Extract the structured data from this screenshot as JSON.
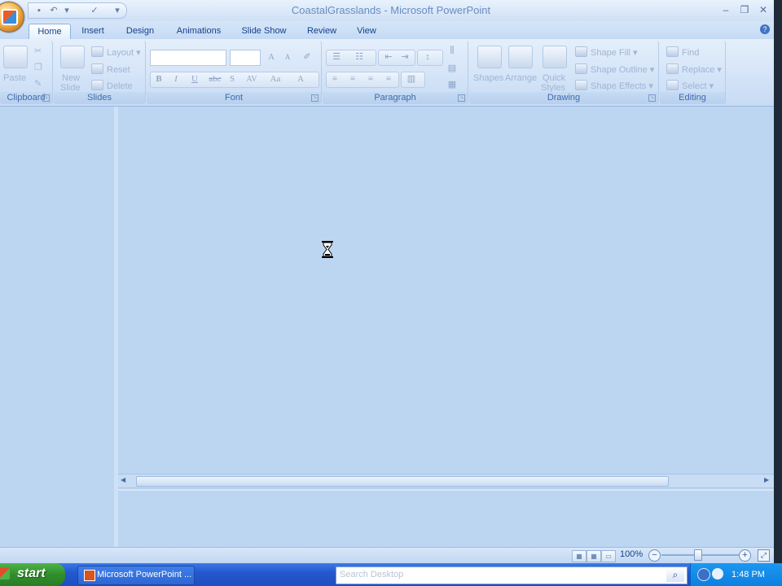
{
  "window": {
    "title": "CoastalGrasslands - Microsoft PowerPoint"
  },
  "quick_access": {
    "items": [
      "save-icon",
      "undo-icon",
      "spelling-icon",
      "customize-icon"
    ]
  },
  "tabs": [
    {
      "label": "Home",
      "active": true
    },
    {
      "label": "Insert"
    },
    {
      "label": "Design"
    },
    {
      "label": "Animations"
    },
    {
      "label": "Slide Show"
    },
    {
      "label": "Review"
    },
    {
      "label": "View"
    }
  ],
  "ribbon": {
    "clipboard": {
      "group_label": "Clipboard",
      "paste": "Paste"
    },
    "slides": {
      "group_label": "Slides",
      "new_slide_line1": "New",
      "new_slide_line2": "Slide",
      "layout": "Layout",
      "reset": "Reset",
      "delete": "Delete"
    },
    "font": {
      "group_label": "Font",
      "bold": "B",
      "italic": "I",
      "underline": "U",
      "strike": "abc",
      "shadow": "S",
      "spacing": "AV",
      "change_case": "Aa",
      "font_color": "A",
      "grow": "A",
      "shrink": "A"
    },
    "paragraph": {
      "group_label": "Paragraph"
    },
    "drawing": {
      "group_label": "Drawing",
      "shapes": "Shapes",
      "arrange": "Arrange",
      "quick_styles_line1": "Quick",
      "quick_styles_line2": "Styles",
      "shape_fill": "Shape Fill",
      "shape_outline": "Shape Outline",
      "shape_effects": "Shape Effects"
    },
    "editing": {
      "group_label": "Editing",
      "find": "Find",
      "replace": "Replace",
      "select": "Select"
    }
  },
  "statusbar": {
    "zoom": "100%",
    "zoom_out": "−",
    "zoom_in": "+"
  },
  "taskbar": {
    "start_label": "start",
    "task_item": "Microsoft PowerPoint ...",
    "search_placeholder": "Search Desktop",
    "clock": "1:48 PM"
  },
  "colors": {
    "accent": "#15428b",
    "workspace": "#bcd6f2",
    "taskbar": "#2558cf",
    "start": "#3a9a35"
  }
}
